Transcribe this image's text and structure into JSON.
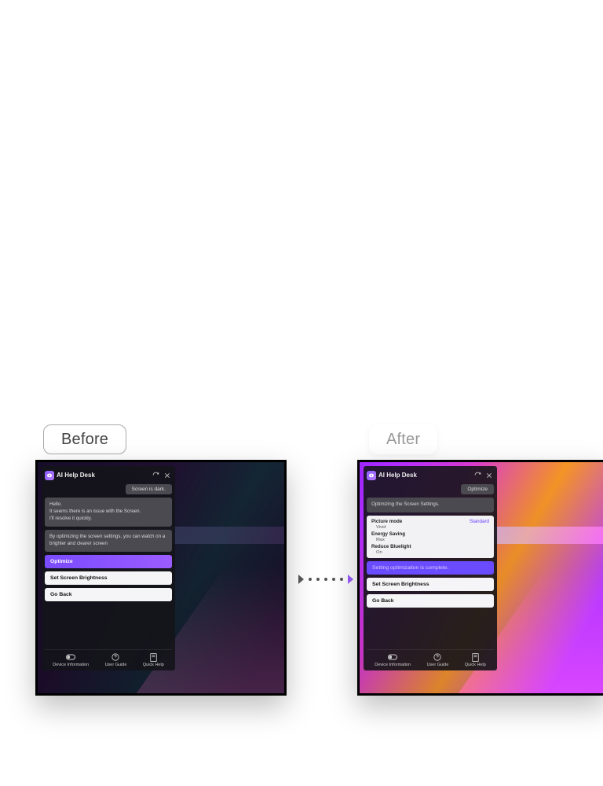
{
  "labels": {
    "before": "Before",
    "after": "After"
  },
  "panel": {
    "title": "AI Help Desk",
    "footer": {
      "device_info": "Device Information",
      "user_guide": "User Guide",
      "quick_help": "Quick Help"
    }
  },
  "before": {
    "user_chip": "Screen is dark.",
    "msg1": "Hello.\nIt seems there is an issue with the Screen.\nI'll resolve it quickly.",
    "msg2": "By optimizing the screen settings, you can watch on a brighter and clearer screen",
    "buttons": {
      "optimize": "Optimize",
      "set_brightness": "Set Screen Brightness",
      "go_back": "Go Back"
    }
  },
  "after": {
    "user_chip": "Optimize",
    "status_msg": "Optimizing the Screen Settings.",
    "settings": {
      "picture_mode": {
        "label": "Picture mode",
        "from": "Vivid",
        "to": "Standard"
      },
      "energy_saving": {
        "label": "Energy Saving",
        "value": "Max"
      },
      "reduce_bluelight": {
        "label": "Reduce Bluelight",
        "value": "On"
      }
    },
    "complete_msg": "Setting optimization is complete.",
    "buttons": {
      "set_brightness": "Set Screen Brightness",
      "go_back": "Go Back"
    }
  }
}
